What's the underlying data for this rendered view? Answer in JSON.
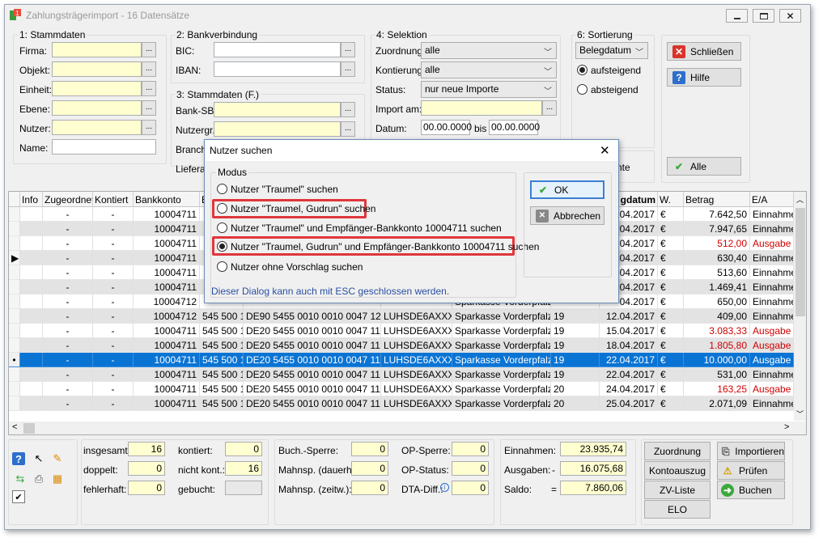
{
  "window": {
    "title": "Zahlungsträgerimport - 16 Datensätze"
  },
  "stammdaten": {
    "title": "1: Stammdaten",
    "firma": "Firma:",
    "objekt": "Objekt:",
    "einheit": "Einheit:",
    "ebene": "Ebene:",
    "nutzer": "Nutzer:",
    "name": "Name:"
  },
  "bank": {
    "title": "2: Bankverbindung",
    "bic": "BIC:",
    "iban": "IBAN:"
  },
  "stammdaten_f": {
    "title": "3: Stammdaten (F.)",
    "banksb": "Bank-SB:",
    "nutzergr": "Nutzergr.:",
    "branche": "Branche",
    "lieferant": "Lieferan"
  },
  "selektion": {
    "title": "4: Selektion",
    "zuordnung": "Zuordnung:",
    "zuordnung_value": "alle",
    "kontierung": "Kontierung:",
    "kontierung_value": "alle",
    "status": "Status:",
    "status_value": "nur neue Importe",
    "import_am": "Import am:",
    "datum": "Datum:",
    "datum_von": "00.00.0000",
    "bis": "bis",
    "datum_bis": "00.00.0000"
  },
  "sortierung": {
    "title": "6: Sortierung",
    "value": "Belegdatum",
    "asc": "aufsteigend",
    "desc": "absteigend",
    "partial": "nte"
  },
  "buttons": {
    "schliessen": "Schließen",
    "hilfe": "Hilfe",
    "alle": "Alle"
  },
  "grid": {
    "headers": [
      "Info",
      "Zugeordnet",
      "Kontiert",
      "Bankkonto",
      "Bl",
      "",
      "",
      "",
      "",
      "gdatum",
      "W.",
      "Betrag",
      "E/A"
    ],
    "rows": [
      {
        "bankkonto": "10004711",
        "blz": "",
        "iban": "",
        "bic": "",
        "bank": "",
        "nr": "",
        "datum": "04.2017",
        "w": "€",
        "betrag": "7.642,50",
        "ea": "Einnahme",
        "red": false
      },
      {
        "bankkonto": "10004711",
        "blz": "",
        "iban": "",
        "bic": "",
        "bank": "",
        "nr": "",
        "datum": "04.2017",
        "w": "€",
        "betrag": "7.947,65",
        "ea": "Einnahme",
        "red": false
      },
      {
        "bankkonto": "10004711",
        "blz": "",
        "iban": "",
        "bic": "",
        "bank": "",
        "nr": "",
        "datum": "04.2017",
        "w": "€",
        "betrag": "512,00",
        "ea": "Ausgabe",
        "red": true
      },
      {
        "bankkonto": "10004711",
        "blz": "",
        "iban": "",
        "bic": "",
        "bank": "",
        "nr": "",
        "datum": "04.2017",
        "w": "€",
        "betrag": "630,40",
        "ea": "Einnahme",
        "red": false
      },
      {
        "bankkonto": "10004711",
        "blz": "",
        "iban": "",
        "bic": "",
        "bank": "",
        "nr": "",
        "datum": "04.2017",
        "w": "€",
        "betrag": "513,60",
        "ea": "Einnahme",
        "red": false
      },
      {
        "bankkonto": "10004711",
        "blz": "",
        "iban": "",
        "bic": "",
        "bank": "",
        "nr": "",
        "datum": "04.2017",
        "w": "€",
        "betrag": "1.469,41",
        "ea": "Einnahme",
        "red": false
      },
      {
        "bankkonto": "10004712",
        "blz": "",
        "iban": "",
        "bic": "",
        "bank": "Sparkasse Vorderpfalz",
        "nr": "",
        "datum": "04.2017",
        "w": "€",
        "betrag": "650,00",
        "ea": "Einnahme",
        "red": false
      },
      {
        "bankkonto": "10004712",
        "blz": "545 500 10",
        "iban": "DE90 5455 0010 0010 0047 12",
        "bic": "LUHSDE6AXXX",
        "bank": "Sparkasse Vorderpfalz",
        "nr": "19",
        "datum": "12.04.2017",
        "w": "€",
        "betrag": "409,00",
        "ea": "Einnahme",
        "red": false
      },
      {
        "bankkonto": "10004711",
        "blz": "545 500 10",
        "iban": "DE20 5455 0010 0010 0047 11",
        "bic": "LUHSDE6AXXX",
        "bank": "Sparkasse Vorderpfalz",
        "nr": "19",
        "datum": "15.04.2017",
        "w": "€",
        "betrag": "3.083,33",
        "ea": "Ausgabe",
        "red": true
      },
      {
        "bankkonto": "10004711",
        "blz": "545 500 10",
        "iban": "DE20 5455 0010 0010 0047 11",
        "bic": "LUHSDE6AXXX",
        "bank": "Sparkasse Vorderpfalz",
        "nr": "19",
        "datum": "18.04.2017",
        "w": "€",
        "betrag": "1.805,80",
        "ea": "Ausgabe",
        "red": true
      },
      {
        "bankkonto": "10004711",
        "blz": "545 500 10",
        "iban": "DE20 5455 0010 0010 0047 11",
        "bic": "LUHSDE6AXXX",
        "bank": "Sparkasse Vorderpfalz",
        "nr": "19",
        "datum": "22.04.2017",
        "w": "€",
        "betrag": "10.000,00",
        "ea": "Ausgabe",
        "red": false
      },
      {
        "bankkonto": "10004711",
        "blz": "545 500 10",
        "iban": "DE20 5455 0010 0010 0047 11",
        "bic": "LUHSDE6AXXX",
        "bank": "Sparkasse Vorderpfalz",
        "nr": "19",
        "datum": "22.04.2017",
        "w": "€",
        "betrag": "531,00",
        "ea": "Einnahme",
        "red": false
      },
      {
        "bankkonto": "10004711",
        "blz": "545 500 10",
        "iban": "DE20 5455 0010 0010 0047 11",
        "bic": "LUHSDE6AXXX",
        "bank": "Sparkasse Vorderpfalz",
        "nr": "20",
        "datum": "24.04.2017",
        "w": "€",
        "betrag": "163,25",
        "ea": "Ausgabe",
        "red": true
      },
      {
        "bankkonto": "10004711",
        "blz": "545 500 10",
        "iban": "DE20 5455 0010 0010 0047 11",
        "bic": "LUHSDE6AXXX",
        "bank": "Sparkasse Vorderpfalz",
        "nr": "20",
        "datum": "25.04.2017",
        "w": "€",
        "betrag": "2.071,09",
        "ea": "Einnahme",
        "red": false
      }
    ]
  },
  "dialog": {
    "title": "Nutzer suchen",
    "modus": "Modus",
    "options": [
      "Nutzer \"Traumel\" suchen",
      "Nutzer \"Traumel, Gudrun\" suchen",
      "Nutzer \"Traumel\" und Empfänger-Bankkonto 10004711 suchen",
      "Nutzer \"Traumel, Gudrun\" und Empfänger-Bankkonto 10004711 suchen",
      "Nutzer ohne Vorschlag suchen"
    ],
    "ok": "OK",
    "cancel": "Abbrechen",
    "note": "Dieser Dialog kann auch mit ESC geschlossen werden."
  },
  "footer": {
    "insgesamt": "insgesamt:",
    "insgesamt_v": "16",
    "doppelt": "doppelt:",
    "doppelt_v": "0",
    "fehlerhaft": "fehlerhaft:",
    "fehlerhaft_v": "0",
    "kontiert": "kontiert:",
    "kontiert_v": "0",
    "nicht_kont": "nicht kont.:",
    "nicht_kont_v": "16",
    "gebucht": "gebucht:",
    "gebucht_v": "",
    "buch_sperre": "Buch.-Sperre:",
    "buch_sperre_v": "0",
    "mahn_dauer": "Mahnsp. (dauerh.):",
    "mahn_dauer_v": "0",
    "mahn_zeit": "Mahnsp. (zeitw.):",
    "mahn_zeit_v": "0",
    "op_sperre": "OP-Sperre:",
    "op_sperre_v": "0",
    "op_status": "OP-Status:",
    "op_status_v": "0",
    "dta_diff": "DTA-Diff.:",
    "dta_diff_v": "0",
    "einnahmen": "Einnahmen:",
    "einnahmen_v": "23.935,74",
    "ausgaben": "Ausgaben:",
    "ausgaben_sign": "-",
    "ausgaben_v": "16.075,68",
    "saldo": "Saldo:",
    "saldo_sign": "=",
    "saldo_v": "7.860,06",
    "b_zuordnung": "Zuordnung",
    "b_kontoauszug": "Kontoauszug",
    "b_zvliste": "ZV-Liste",
    "b_elo": "ELO",
    "b_importieren": "Importieren",
    "b_pruefen": "Prüfen",
    "b_buchen": "Buchen"
  }
}
